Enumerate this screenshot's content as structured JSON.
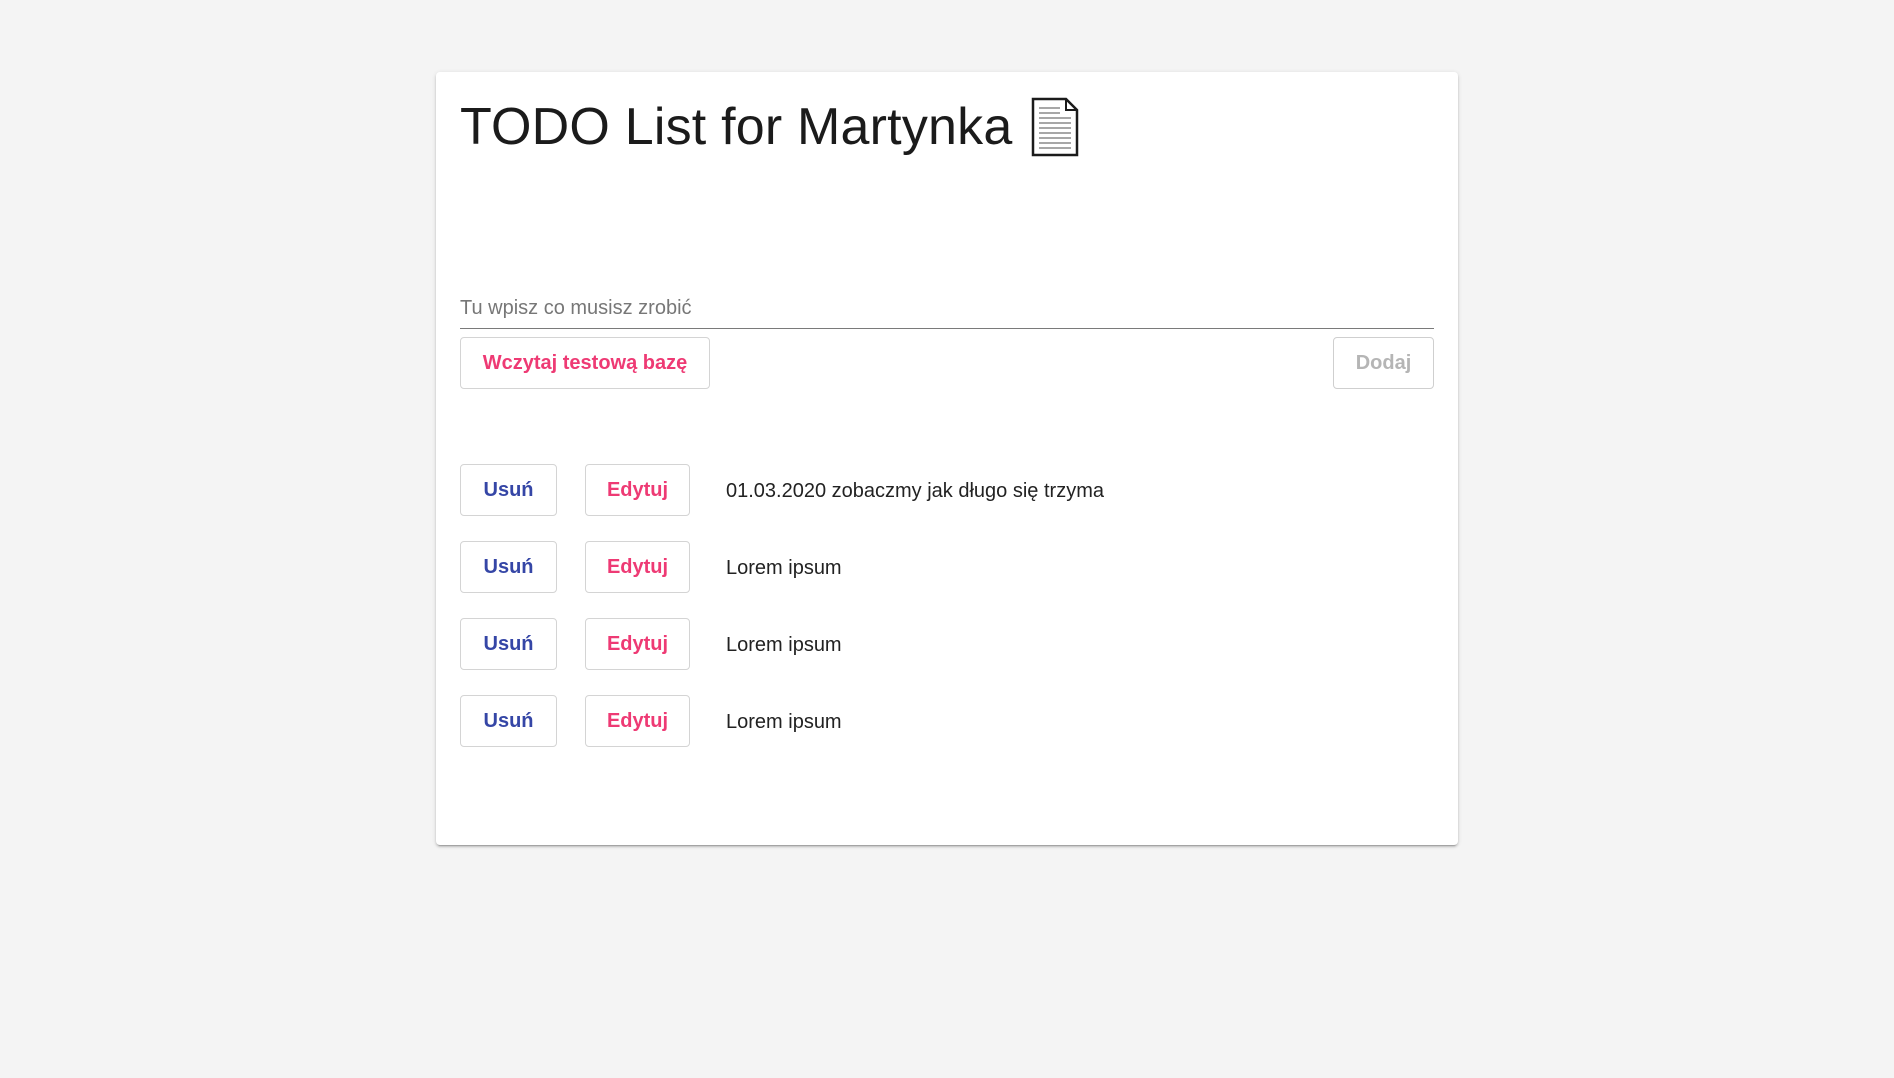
{
  "header": {
    "title": "TODO List for Martynka",
    "title_icon": "document-icon"
  },
  "input": {
    "placeholder": "Tu wpisz co musisz zrobić",
    "value": ""
  },
  "actions": {
    "load_label": "Wczytaj testową bazę",
    "add_label": "Dodaj"
  },
  "todos": [
    {
      "delete_label": "Usuń",
      "edit_label": "Edytuj",
      "text": "01.03.2020 zobaczmy jak długo się trzyma"
    },
    {
      "delete_label": "Usuń",
      "edit_label": "Edytuj",
      "text": "Lorem ipsum"
    },
    {
      "delete_label": "Usuń",
      "edit_label": "Edytuj",
      "text": "Lorem ipsum"
    },
    {
      "delete_label": "Usuń",
      "edit_label": "Edytuj",
      "text": "Lorem ipsum"
    }
  ],
  "colors": {
    "accent": "#ee3a74",
    "primary": "#3546a6",
    "background": "#f4f4f4",
    "disabled": "#b5b5b5"
  }
}
